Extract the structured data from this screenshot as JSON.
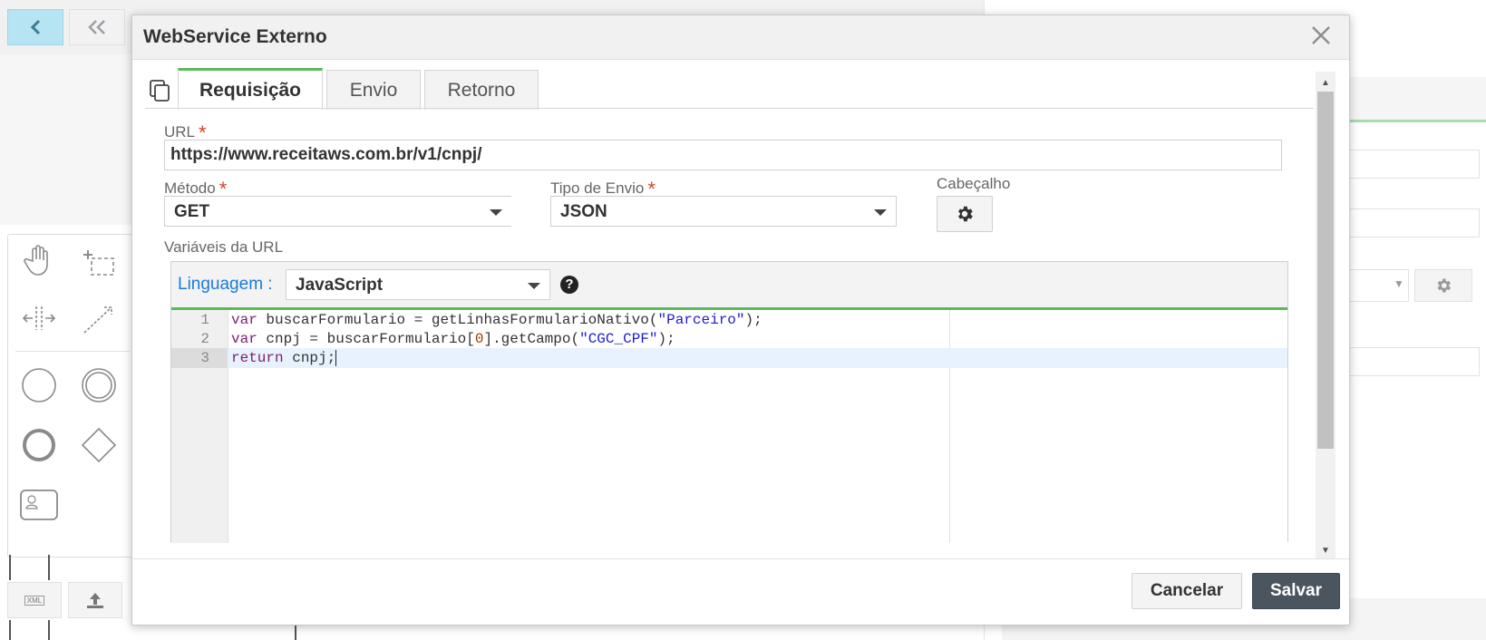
{
  "dialog": {
    "title": "WebService Externo",
    "close_icon": "close-icon"
  },
  "tabs": [
    {
      "label": "Requisição",
      "active": true
    },
    {
      "label": "Envio",
      "active": false
    },
    {
      "label": "Retorno",
      "active": false
    }
  ],
  "form": {
    "url_label": "URL",
    "url_value": "https://www.receitaws.com.br/v1/cnpj/",
    "method_label": "Método",
    "method_value": "GET",
    "send_type_label": "Tipo de Envio",
    "send_type_value": "JSON",
    "header_label": "Cabeçalho",
    "url_vars_label": "Variáveis da URL",
    "required_mark": "*"
  },
  "editor": {
    "language_label": "Linguagem :",
    "language_value": "JavaScript",
    "help_icon": "?",
    "lines": [
      {
        "num": "1",
        "tokens": [
          [
            "kw",
            "var"
          ],
          [
            "txt",
            " buscarFormulario = getLinhasFormularioNativo("
          ],
          [
            "str",
            "\"Parceiro\""
          ],
          [
            "txt",
            ");"
          ]
        ]
      },
      {
        "num": "2",
        "tokens": [
          [
            "kw",
            "var"
          ],
          [
            "txt",
            " cnpj = buscarFormulario["
          ],
          [
            "num",
            "0"
          ],
          [
            "txt",
            "].getCampo("
          ],
          [
            "str",
            "\"CGC_CPF\""
          ],
          [
            "txt",
            ");"
          ]
        ]
      },
      {
        "num": "3",
        "tokens": [
          [
            "kw",
            "return"
          ],
          [
            "txt",
            " cnpj;"
          ]
        ]
      }
    ],
    "active_line": 3
  },
  "footer": {
    "cancel_label": "Cancelar",
    "save_label": "Salvar"
  },
  "background": {
    "xml_label": "XML"
  },
  "colors": {
    "accent_green": "#5cb85c",
    "required_red": "#d9412b",
    "link_blue": "#1a7bd8",
    "save_button": "#4a5560"
  }
}
